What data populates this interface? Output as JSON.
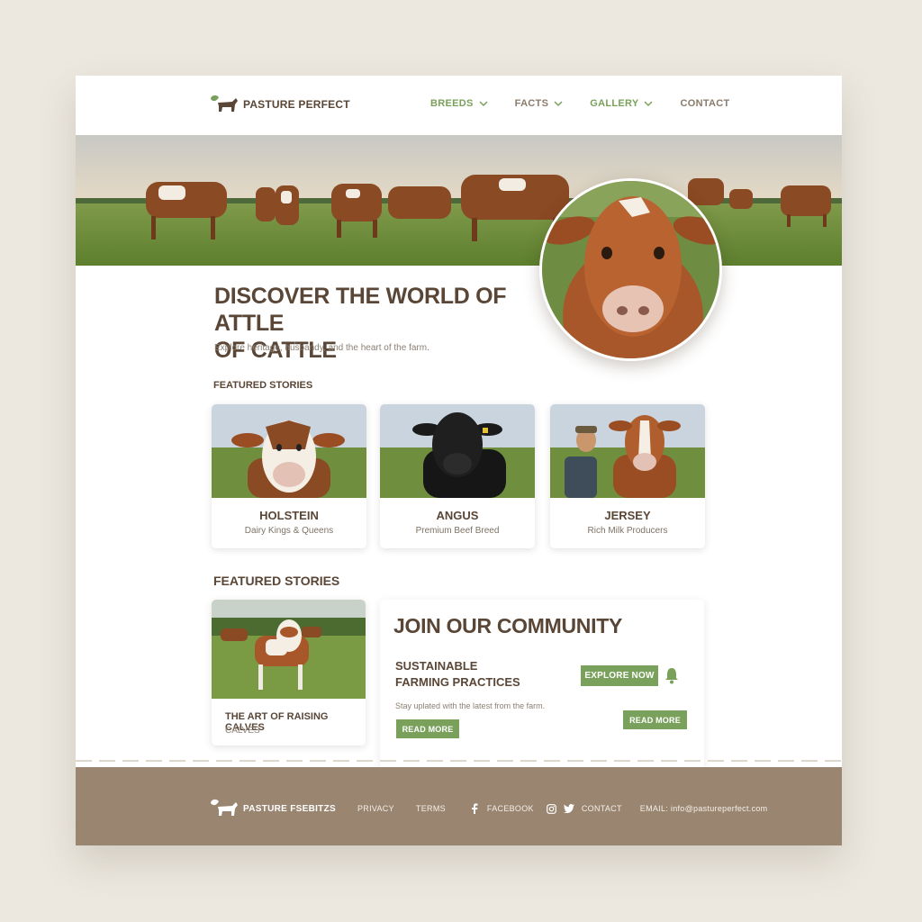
{
  "brand": {
    "name": "PASTURE PERFECT"
  },
  "nav": [
    {
      "label": "BREEDS",
      "dropdown": true
    },
    {
      "label": "FACTS",
      "dropdown": true
    },
    {
      "label": "GALLERY",
      "dropdown": true
    },
    {
      "label": "CONTACT",
      "dropdown": false
    }
  ],
  "hero": {
    "title_line1": "DISCOVER THE WORLD OF ATTLE",
    "title_line2": "OF CATTLE",
    "subtitle": "Explore heritage, husbandy, and the heart of the farm."
  },
  "featured_label_1": "FEATURED STORIES",
  "breeds": [
    {
      "name": "HOLSTEIN",
      "subtitle": "Dairy Kings & Queens"
    },
    {
      "name": "ANGUS",
      "subtitle": "Premium Beef Breed"
    },
    {
      "name": "JERSEY",
      "subtitle": "Rich Milk Producers"
    }
  ],
  "featured_label_2": "FEATURED STORIES",
  "story": {
    "title": "THE ART OF RAISING CALVES",
    "subtitle": "CALVES",
    "button": "READ MORE"
  },
  "community": {
    "title": "JOIN OUR COMMUNITY",
    "subtitle_line1": "SUSTAINABLE",
    "subtitle_line2": "FARMING PRACTICES",
    "text": "Stay uplated with the latest from the farm.",
    "explore_button": "EXPLORE NOW",
    "read_button": "READ MORE"
  },
  "footer": {
    "logo_text": "PASTURE FSEBITZS",
    "privacy": "PRIVACY",
    "terms": "TERMS",
    "facebook": "FACEBOOK",
    "contact": "CONTACT",
    "email": "EMAIL: info@pastureperfect.com"
  },
  "colors": {
    "accent_green": "#7aa15c",
    "brand_brown": "#5a4636",
    "footer_bg": "#9a8570",
    "page_bg": "#ece8df"
  }
}
